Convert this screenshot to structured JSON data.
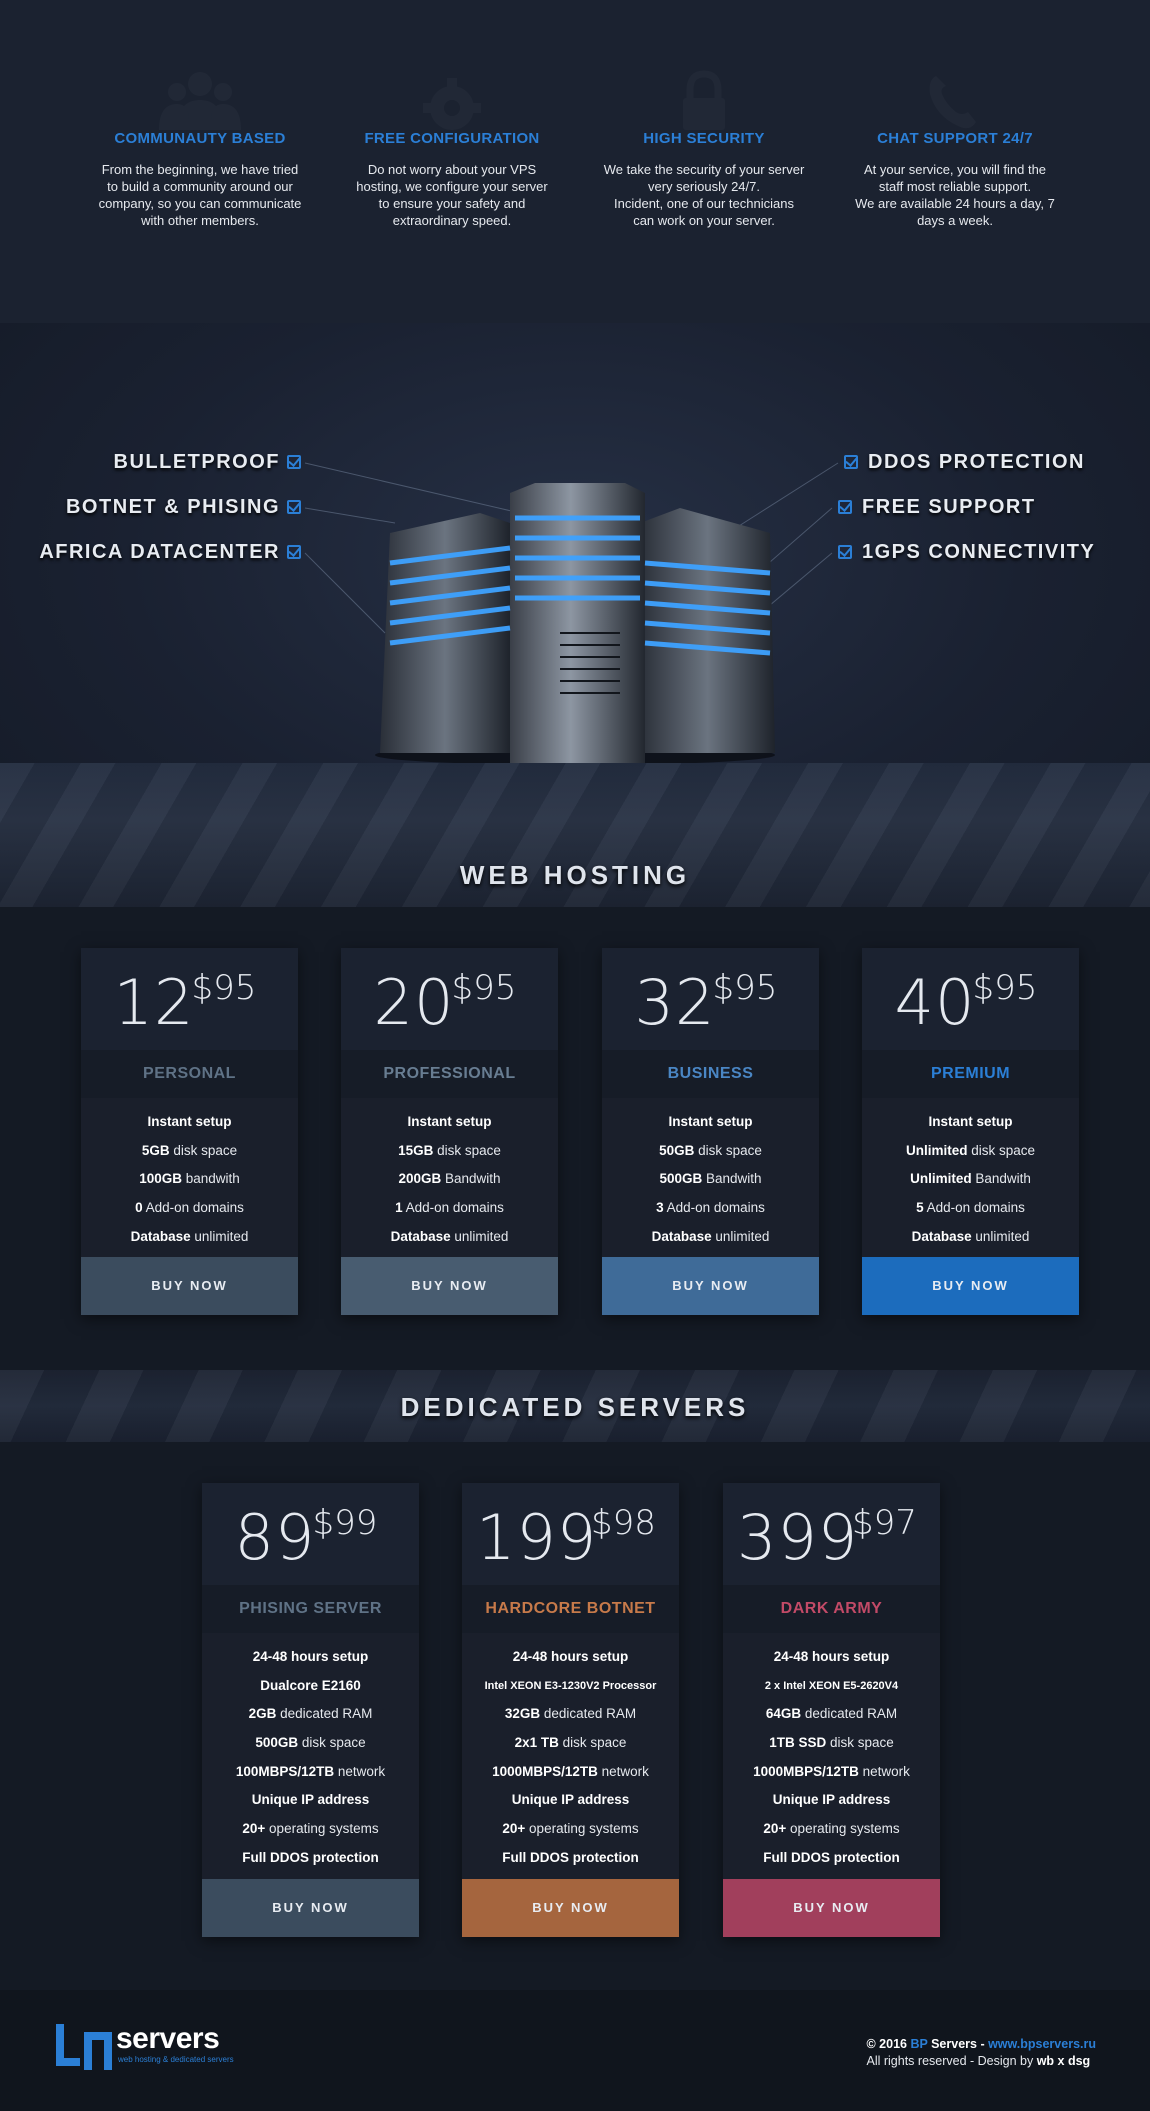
{
  "features": [
    {
      "icon": "community-icon",
      "title": "COMMUNAUTY BASED",
      "lines": [
        "From the beginning, we have tried",
        "to build a community around our",
        "company, so you can communicate",
        "with other members."
      ]
    },
    {
      "icon": "gear-icon",
      "title": "FREE CONFIGURATION",
      "lines": [
        "Do not worry about your VPS",
        "hosting, we configure your server",
        "to ensure your safety and",
        "extraordinary speed."
      ]
    },
    {
      "icon": "lock-icon",
      "title": "HIGH SECURITY",
      "lines": [
        "We take the security of your server",
        "very seriously 24/7.",
        "Incident, one of our technicians",
        "can work on your server."
      ]
    },
    {
      "icon": "phone-icon",
      "title": "CHAT SUPPORT 24/7",
      "lines": [
        "At your service, you will find the",
        "staff most reliable support.",
        "We are available 24 hours a day, 7",
        "days a week."
      ]
    }
  ],
  "hero": {
    "left_features": [
      "BULLETPROOF",
      "BOTNET & PHISING",
      "AFRICA DATACENTER"
    ],
    "right_features": [
      "DDOS PROTECTION",
      "FREE SUPPORT",
      "1GPS CONNECTIVITY"
    ],
    "title": "WEB HOSTING"
  },
  "web_hosting": [
    {
      "price": "12",
      "cents": "$95",
      "name": "PERSONAL",
      "name_color": "#5f7286",
      "button": "BUY NOW",
      "button_color": "#3b4c5e",
      "specs": [
        [
          "Instant setup",
          ""
        ],
        [
          "5GB",
          " disk space"
        ],
        [
          "100GB",
          " bandwith"
        ],
        [
          "0",
          " Add-on domains"
        ],
        [
          "Database",
          " unlimited"
        ]
      ]
    },
    {
      "price": "20",
      "cents": "$95",
      "name": "PROFESSIONAL",
      "name_color": "#687d92",
      "button": "BUY NOW",
      "button_color": "#485c70",
      "specs": [
        [
          "Instant setup",
          ""
        ],
        [
          "15GB",
          " disk space"
        ],
        [
          "200GB",
          " Bandwith"
        ],
        [
          "1",
          " Add-on domains"
        ],
        [
          "Database",
          " unlimited"
        ]
      ]
    },
    {
      "price": "32",
      "cents": "$95",
      "name": "BUSINESS",
      "name_color": "#4a86c4",
      "button": "BUY NOW",
      "button_color": "#3f6b98",
      "specs": [
        [
          "Instant setup",
          ""
        ],
        [
          "50GB",
          " disk space"
        ],
        [
          "500GB",
          " Bandwith"
        ],
        [
          "3",
          " Add-on domains"
        ],
        [
          "Database",
          " unlimited"
        ]
      ]
    },
    {
      "price": "40",
      "cents": "$95",
      "name": "PREMIUM",
      "name_color": "#2b7fd6",
      "button": "BUY NOW",
      "button_color": "#1c6cbd",
      "specs": [
        [
          "Instant setup",
          ""
        ],
        [
          "Unlimited",
          " disk space"
        ],
        [
          "Unlimited",
          " Bandwith"
        ],
        [
          "5",
          " Add-on domains"
        ],
        [
          "Database",
          " unlimited"
        ]
      ]
    }
  ],
  "dedicated_title": "DEDICATED SERVERS",
  "dedicated": [
    {
      "price": "89",
      "cents": "$99",
      "name": "PHISING SERVER",
      "name_color": "#5f7286",
      "button": "BUY NOW",
      "button_color": "#3b4c5e",
      "specs": [
        [
          "24-48 hours setup",
          "",
          ""
        ],
        [
          "Dualcore E2160",
          "",
          ""
        ],
        [
          "2GB",
          " dedicated RAM",
          ""
        ],
        [
          "500GB",
          " disk space",
          ""
        ],
        [
          "100MBPS/12TB",
          " network",
          ""
        ],
        [
          "Unique IP address",
          "",
          ""
        ],
        [
          "20+",
          " operating systems",
          ""
        ],
        [
          "Full DDOS protection",
          "",
          ""
        ]
      ]
    },
    {
      "price": "199",
      "cents": "$98",
      "name": "HARDCORE BOTNET",
      "name_color": "#c77a4a",
      "button": "BUY NOW",
      "button_color": "#a5653e",
      "specs": [
        [
          "24-48 hours setup",
          "",
          ""
        ],
        [
          "Intel XEON E3-1230V2 Processor",
          "",
          "small"
        ],
        [
          "32GB",
          " dedicated RAM",
          ""
        ],
        [
          "2x1 TB",
          " disk space",
          ""
        ],
        [
          "1000MBPS/12TB",
          " network",
          ""
        ],
        [
          "Unique IP address",
          "",
          ""
        ],
        [
          "20+",
          " operating systems",
          ""
        ],
        [
          "Full DDOS protection",
          "",
          ""
        ]
      ]
    },
    {
      "price": "399",
      "cents": "$97",
      "name": "DARK ARMY",
      "name_color": "#c24a67",
      "button": "BUY NOW",
      "button_color": "#a13f5c",
      "specs": [
        [
          "24-48 hours setup",
          "",
          ""
        ],
        [
          "2 x Intel XEON E5-2620V4",
          "",
          "small"
        ],
        [
          "64GB",
          " dedicated RAM",
          ""
        ],
        [
          "1TB SSD",
          " disk space",
          ""
        ],
        [
          "1000MBPS/12TB",
          " network",
          ""
        ],
        [
          "Unique IP address",
          "",
          ""
        ],
        [
          "20+",
          " operating systems",
          ""
        ],
        [
          "Full DDOS protection",
          "",
          ""
        ]
      ]
    }
  ],
  "footer": {
    "logo_word": "servers",
    "logo_tag": "web hosting & dedicated servers",
    "copyright_prefix": "© 2016 ",
    "brand_bp": "BP",
    "brand_servers": " Servers",
    "dash": " - ",
    "site": "www.bpservers.ru",
    "rights": "All rights reserved - Design by ",
    "designer": "wb x dsg"
  },
  "colors": {
    "accent": "#2b7fd6",
    "bg": "#141a24"
  }
}
